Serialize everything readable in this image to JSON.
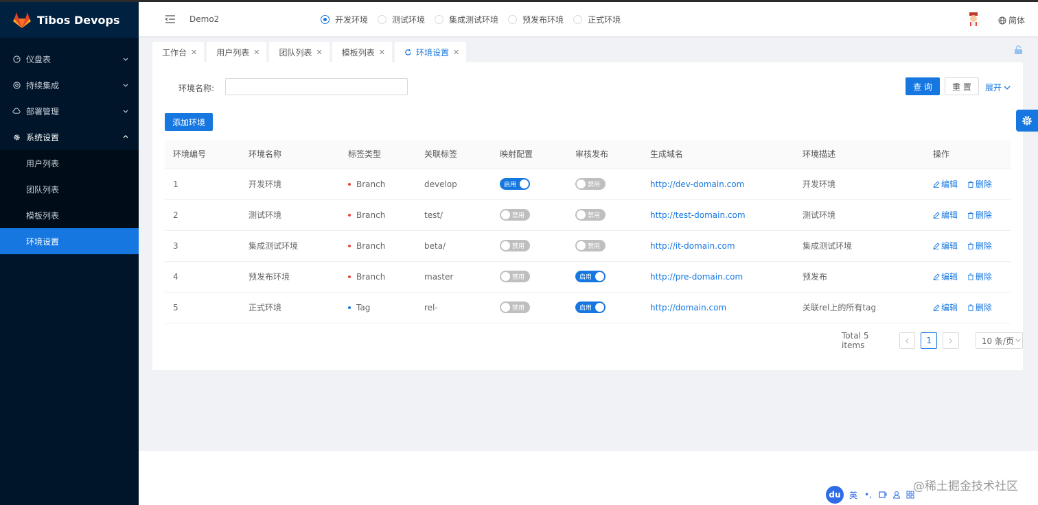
{
  "app": {
    "title": "Tibos Devops",
    "project": "Demo2",
    "lang": "简体"
  },
  "sidebar": {
    "items": [
      {
        "label": "仪盘表",
        "icon": "dashboard-icon",
        "expanded": false
      },
      {
        "label": "持续集成",
        "icon": "integration-icon",
        "expanded": false
      },
      {
        "label": "部署管理",
        "icon": "cloud-icon",
        "expanded": false
      },
      {
        "label": "系统设置",
        "icon": "gear-icon",
        "expanded": true
      }
    ],
    "sub_items": [
      "用户列表",
      "团队列表",
      "模板列表",
      "环境设置"
    ],
    "active_sub": "环境设置"
  },
  "header": {
    "envs": [
      "开发环境",
      "测试环境",
      "集成测试环境",
      "预发布环境",
      "正式环境"
    ],
    "selected_env": "开发环境"
  },
  "tabs": [
    "工作台",
    "用户列表",
    "团队列表",
    "模板列表",
    "环境设置"
  ],
  "active_tab": "环境设置",
  "filter": {
    "label": "环境名称:",
    "value": "",
    "placeholder": ""
  },
  "buttons": {
    "query": "查 询",
    "reset": "重 置",
    "expand": "展开",
    "add": "添加环境"
  },
  "table": {
    "columns": [
      "环境编号",
      "环境名称",
      "标签类型",
      "关联标签",
      "映射配置",
      "审核发布",
      "生成域名",
      "环境描述",
      "操作"
    ],
    "rows": [
      {
        "id": "1",
        "name": "开发环境",
        "tag_type": "Branch",
        "tag": "develop",
        "mapping": "启用",
        "review": "禁用",
        "domain": "http://dev-domain.com",
        "desc": "开发环境"
      },
      {
        "id": "2",
        "name": "测试环境",
        "tag_type": "Branch",
        "tag": "test/",
        "mapping": "禁用",
        "review": "禁用",
        "domain": "http://test-domain.com",
        "desc": "测试环境"
      },
      {
        "id": "3",
        "name": "集成测试环境",
        "tag_type": "Branch",
        "tag": "beta/",
        "mapping": "禁用",
        "review": "禁用",
        "domain": "http://it-domain.com",
        "desc": "集成测试环境"
      },
      {
        "id": "4",
        "name": "预发布环境",
        "tag_type": "Branch",
        "tag": "master",
        "mapping": "禁用",
        "review": "启用",
        "domain": "http://pre-domain.com",
        "desc": "预发布"
      },
      {
        "id": "5",
        "name": "正式环境",
        "tag_type": "Tag",
        "tag": "rel-",
        "mapping": "禁用",
        "review": "启用",
        "domain": "http://domain.com",
        "desc": "关联rel上的所有tag"
      }
    ],
    "actions": {
      "edit": "编辑",
      "delete": "删除"
    }
  },
  "pagination": {
    "total": "Total 5 items",
    "current": "1",
    "size": "10 条/页"
  },
  "colors": {
    "primary": "#1677e0",
    "sidebar_bg": "#001529",
    "branch_dot": "#e8443b",
    "tag_dot": "#1677e0"
  },
  "ime": {
    "logo": "du",
    "mode": "英"
  },
  "watermark": "@稀土掘金技术社区"
}
